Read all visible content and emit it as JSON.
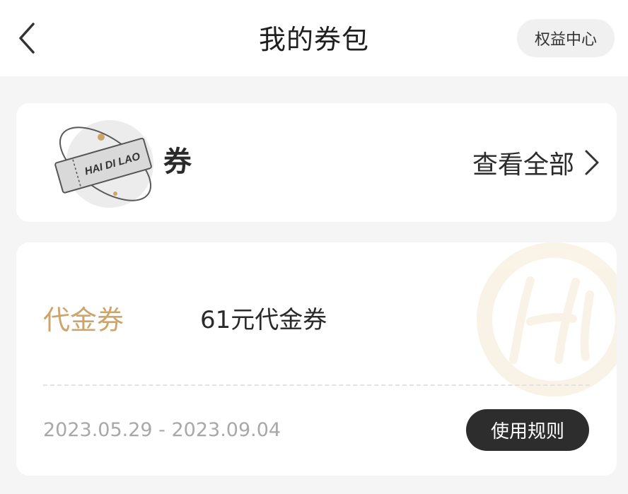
{
  "header": {
    "title": "我的券包",
    "rights_button": "权益中心"
  },
  "coupons_section": {
    "title": "券",
    "view_all": "查看全部",
    "logo_text": "HAI DI LAO"
  },
  "coupon": {
    "type": "代金券",
    "name": "61元代金券",
    "dates": "2023.05.29 - 2023.09.04",
    "rules_button": "使用规则"
  },
  "colors": {
    "accent_gold": "#cda56b",
    "dark_button": "#2d2d2d",
    "background": "#f5f5f5"
  },
  "icons": {
    "back": "chevron-left-icon",
    "view_all": "chevron-right-icon"
  }
}
